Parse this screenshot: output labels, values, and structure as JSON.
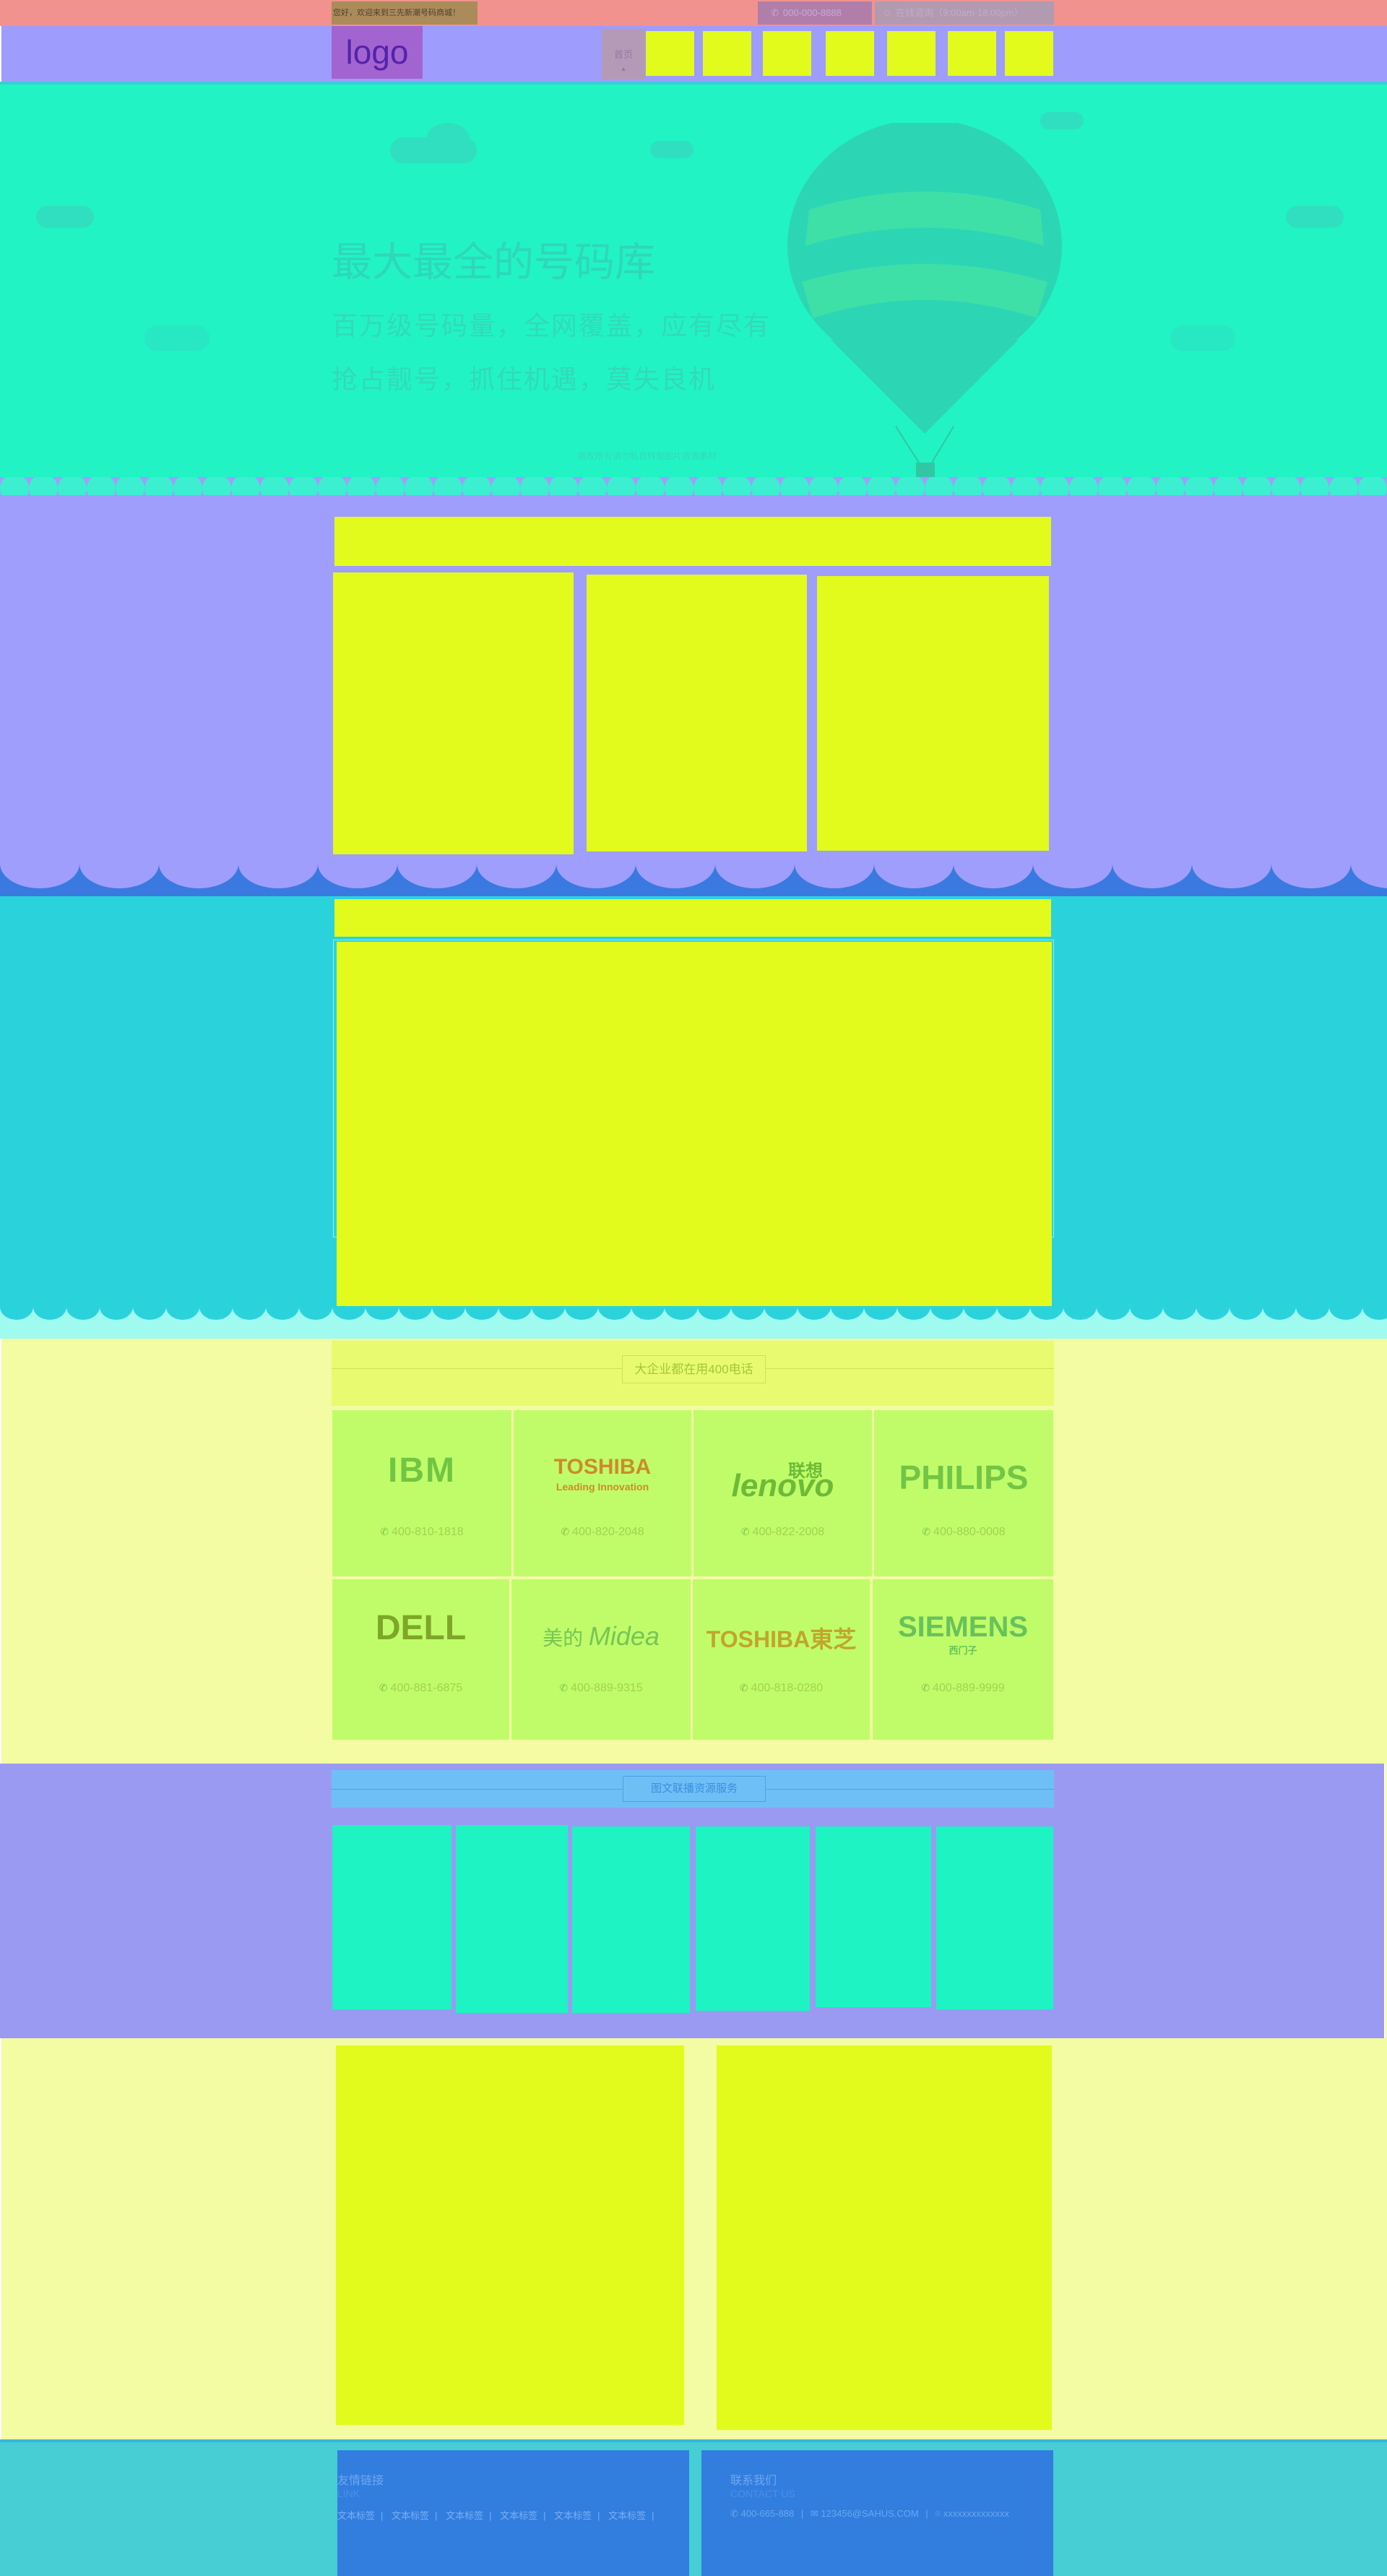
{
  "topbar": {
    "welcome": "您好，欢迎来到三先新潮号码商城！",
    "phone": "000-000-8888",
    "consult": "在线咨询（9:00am-18:00pm）"
  },
  "header": {
    "logo": "logo",
    "nav_home": "首页",
    "nav_home_arrow": "▲"
  },
  "hero": {
    "title": "最大最全的号码库",
    "subtitle1": "百万级号码量，全网覆盖，应有尽有",
    "subtitle2": "抢占靓号，抓住机遇，莫失良机",
    "caption": "版权所有请勿私自转载图片资源素材"
  },
  "brands": {
    "heading": "大企业都在用400电话",
    "items": [
      {
        "name": "IBM",
        "phone": "400-810-1818",
        "color": "#71c542"
      },
      {
        "name": "TOSHIBA",
        "tagline": "Leading Innovation",
        "phone": "400-820-2048",
        "color": "#cc8b2b"
      },
      {
        "name": "lenovo",
        "name_cn": "联想",
        "phone": "400-822-2008",
        "color": "#6cba38"
      },
      {
        "name": "PHILIPS",
        "phone": "400-880-0008",
        "color": "#72c546"
      },
      {
        "name": "DELL",
        "phone": "400-881-6875",
        "color": "#7da728"
      },
      {
        "name": "美的",
        "name_en": "Midea",
        "phone": "400-889-9315",
        "color": "#78c555"
      },
      {
        "name": "TOSHIBA東芝",
        "phone": "400-818-0280",
        "color": "#c1a62b"
      },
      {
        "name": "SIEMENS",
        "name_cn": "西门子",
        "phone": "400-889-9999",
        "color": "#67c25c"
      }
    ]
  },
  "services": {
    "heading": "图文联播资源服务"
  },
  "footer": {
    "links_title": "友情链接",
    "links_sub": "LINK",
    "links": [
      "文本标签",
      "文本标签",
      "文本标签",
      "文本标签",
      "文本标签",
      "文本标签"
    ],
    "contact_title": "联系我们",
    "contact_sub": "CONTACT US",
    "phone": "400-665-888",
    "email": "123456@SAHUS.COM",
    "address": "xxxxxxxxxxxxxx"
  }
}
